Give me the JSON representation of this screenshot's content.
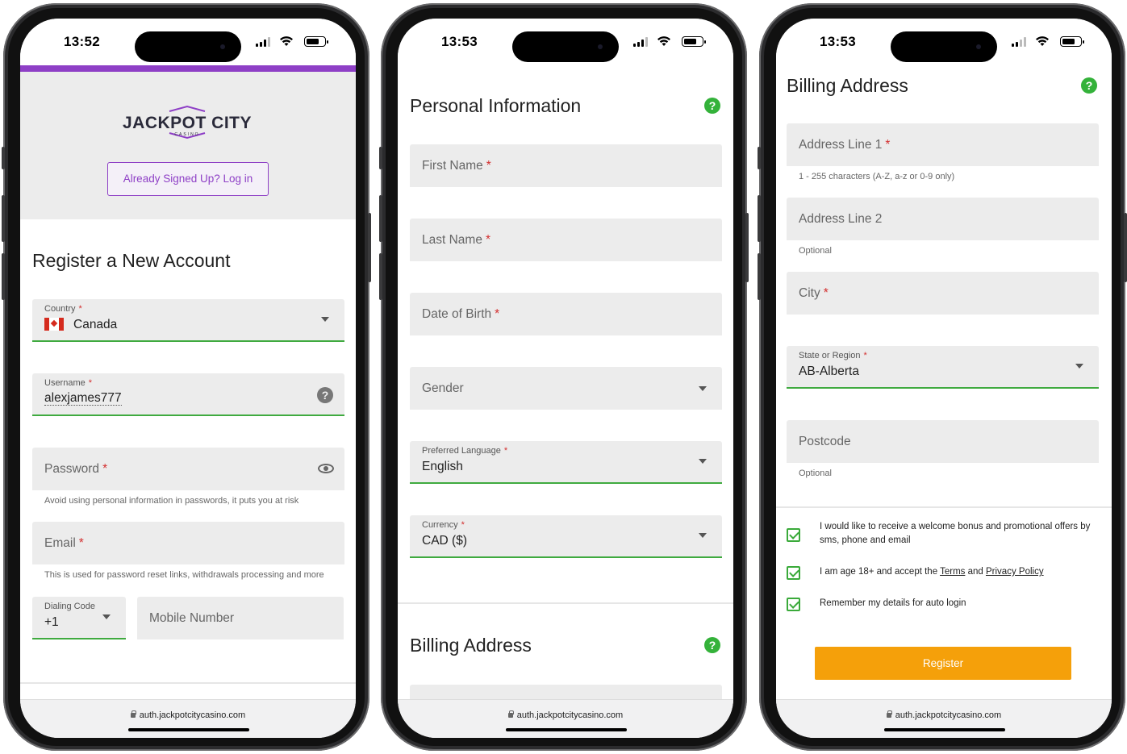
{
  "status_bars": [
    {
      "time": "13:52"
    },
    {
      "time": "13:53"
    },
    {
      "time": "13:53"
    }
  ],
  "url": "auth.jackpotcitycasino.com",
  "screen1": {
    "logo_text": "JACKPOT CITY",
    "logo_sub": "CASINO",
    "login_button": "Already Signed Up? Log in",
    "title": "Register a New Account",
    "country": {
      "label": "Country",
      "value": "Canada"
    },
    "username": {
      "label": "Username",
      "value": "alexjames777"
    },
    "password": {
      "placeholder": "Password",
      "helper": "Avoid using personal information in passwords, it puts you at risk"
    },
    "email": {
      "placeholder": "Email",
      "helper": "This is used for password reset links, withdrawals processing and more"
    },
    "dialing_code": {
      "label": "Dialing Code",
      "value": "+1"
    },
    "mobile": {
      "placeholder": "Mobile Number"
    },
    "accent_color": "#8e3fc6"
  },
  "screen2": {
    "title": "Personal Information",
    "first_name": "First Name",
    "last_name": "Last Name",
    "dob": "Date of Birth",
    "gender": "Gender",
    "language": {
      "label": "Preferred Language",
      "value": "English"
    },
    "currency": {
      "label": "Currency",
      "value": "CAD ($)"
    },
    "billing_title": "Billing Address"
  },
  "screen3": {
    "title": "Billing Address",
    "address1": {
      "placeholder": "Address Line 1",
      "helper": "1 - 255 characters (A-Z, a-z or 0-9 only)"
    },
    "address2": {
      "placeholder": "Address Line 2",
      "helper": "Optional"
    },
    "city": {
      "placeholder": "City"
    },
    "state": {
      "label": "State or Region",
      "value": "AB-Alberta"
    },
    "postcode": {
      "placeholder": "Postcode",
      "helper": "Optional"
    },
    "consent_promo": "I would like to receive a welcome bonus and promotional offers by sms, phone and email",
    "consent_age_prefix": "I am age 18+ and accept the",
    "consent_terms": "Terms",
    "consent_and": "and",
    "consent_privacy": "Privacy Policy",
    "consent_remember": "Remember my details for auto login",
    "register_button": "Register",
    "register_color": "#f5a00a"
  },
  "required_marker": "*",
  "help_glyph": "?"
}
